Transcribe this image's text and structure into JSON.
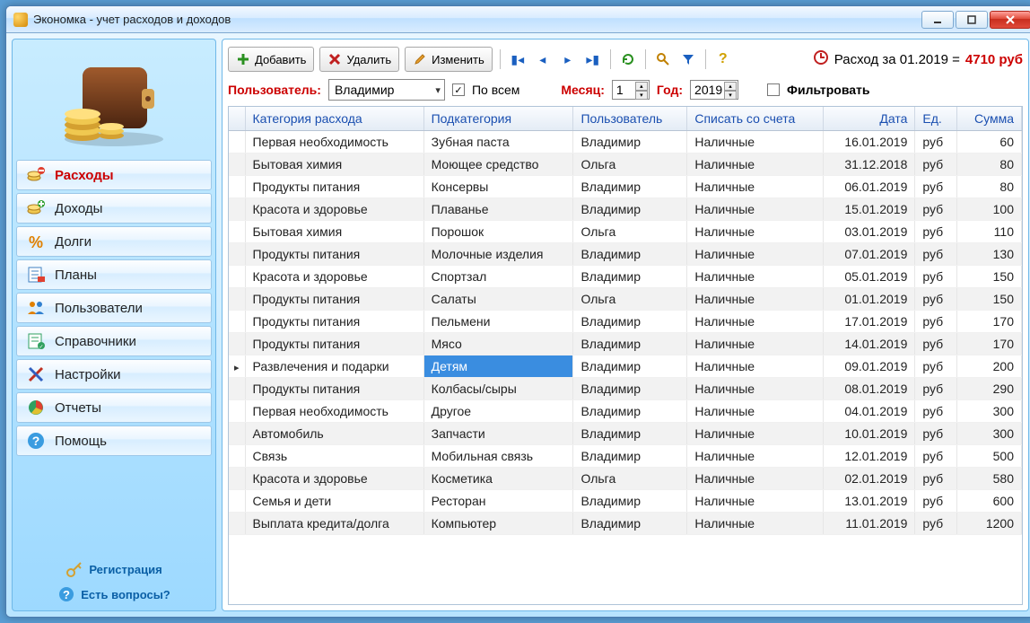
{
  "window": {
    "title": "Экономка - учет расходов и доходов"
  },
  "sidebar": {
    "items": [
      {
        "label": "Расходы",
        "active": true
      },
      {
        "label": "Доходы"
      },
      {
        "label": "Долги"
      },
      {
        "label": "Планы"
      },
      {
        "label": "Пользователи"
      },
      {
        "label": "Справочники"
      },
      {
        "label": "Настройки"
      },
      {
        "label": "Отчеты"
      },
      {
        "label": "Помощь"
      }
    ],
    "register": "Регистрация",
    "questions": "Есть вопросы?"
  },
  "toolbar": {
    "add": "Добавить",
    "delete": "Удалить",
    "edit": "Изменить",
    "summary_prefix": "Расход за 01.2019 = ",
    "summary_value": "4710 руб"
  },
  "filter": {
    "user_label": "Пользователь:",
    "user_value": "Владимир",
    "all_label": "По всем",
    "all_checked": true,
    "month_label": "Месяц:",
    "month_value": "1",
    "year_label": "Год:",
    "year_value": "2019",
    "filter_label": "Фильтровать",
    "filter_checked": false
  },
  "columns": [
    "Категория расхода",
    "Подкатегория",
    "Пользователь",
    "Списать со счета",
    "Дата",
    "Ед.",
    "Сумма"
  ],
  "rows": [
    {
      "cat": "Первая необходимость",
      "sub": "Зубная паста",
      "user": "Владимир",
      "acc": "Наличные",
      "date": "16.01.2019",
      "unit": "руб",
      "sum": "60"
    },
    {
      "cat": "Бытовая химия",
      "sub": "Моющее средство",
      "user": "Ольга",
      "acc": "Наличные",
      "date": "31.12.2018",
      "unit": "руб",
      "sum": "80"
    },
    {
      "cat": "Продукты питания",
      "sub": "Консервы",
      "user": "Владимир",
      "acc": "Наличные",
      "date": "06.01.2019",
      "unit": "руб",
      "sum": "80"
    },
    {
      "cat": "Красота и здоровье",
      "sub": "Плаванье",
      "user": "Владимир",
      "acc": "Наличные",
      "date": "15.01.2019",
      "unit": "руб",
      "sum": "100"
    },
    {
      "cat": "Бытовая химия",
      "sub": "Порошок",
      "user": "Ольга",
      "acc": "Наличные",
      "date": "03.01.2019",
      "unit": "руб",
      "sum": "110"
    },
    {
      "cat": "Продукты питания",
      "sub": "Молочные изделия",
      "user": "Владимир",
      "acc": "Наличные",
      "date": "07.01.2019",
      "unit": "руб",
      "sum": "130"
    },
    {
      "cat": "Красота и здоровье",
      "sub": "Спортзал",
      "user": "Владимир",
      "acc": "Наличные",
      "date": "05.01.2019",
      "unit": "руб",
      "sum": "150"
    },
    {
      "cat": "Продукты питания",
      "sub": "Салаты",
      "user": "Ольга",
      "acc": "Наличные",
      "date": "01.01.2019",
      "unit": "руб",
      "sum": "150"
    },
    {
      "cat": "Продукты питания",
      "sub": "Пельмени",
      "user": "Владимир",
      "acc": "Наличные",
      "date": "17.01.2019",
      "unit": "руб",
      "sum": "170"
    },
    {
      "cat": "Продукты питания",
      "sub": "Мясо",
      "user": "Владимир",
      "acc": "Наличные",
      "date": "14.01.2019",
      "unit": "руб",
      "sum": "170"
    },
    {
      "cat": "Развлечения и подарки",
      "sub": "Детям",
      "user": "Владимир",
      "acc": "Наличные",
      "date": "09.01.2019",
      "unit": "руб",
      "sum": "200",
      "selected": true
    },
    {
      "cat": "Продукты питания",
      "sub": "Колбасы/сыры",
      "user": "Владимир",
      "acc": "Наличные",
      "date": "08.01.2019",
      "unit": "руб",
      "sum": "290"
    },
    {
      "cat": "Первая необходимость",
      "sub": "Другое",
      "user": "Владимир",
      "acc": "Наличные",
      "date": "04.01.2019",
      "unit": "руб",
      "sum": "300"
    },
    {
      "cat": "Автомобиль",
      "sub": "Запчасти",
      "user": "Владимир",
      "acc": "Наличные",
      "date": "10.01.2019",
      "unit": "руб",
      "sum": "300"
    },
    {
      "cat": "Связь",
      "sub": "Мобильная связь",
      "user": "Владимир",
      "acc": "Наличные",
      "date": "12.01.2019",
      "unit": "руб",
      "sum": "500"
    },
    {
      "cat": "Красота и здоровье",
      "sub": "Косметика",
      "user": "Ольга",
      "acc": "Наличные",
      "date": "02.01.2019",
      "unit": "руб",
      "sum": "580"
    },
    {
      "cat": "Семья и дети",
      "sub": "Ресторан",
      "user": "Владимир",
      "acc": "Наличные",
      "date": "13.01.2019",
      "unit": "руб",
      "sum": "600"
    },
    {
      "cat": "Выплата кредита/долга",
      "sub": "Компьютер",
      "user": "Владимир",
      "acc": "Наличные",
      "date": "11.01.2019",
      "unit": "руб",
      "sum": "1200"
    }
  ]
}
